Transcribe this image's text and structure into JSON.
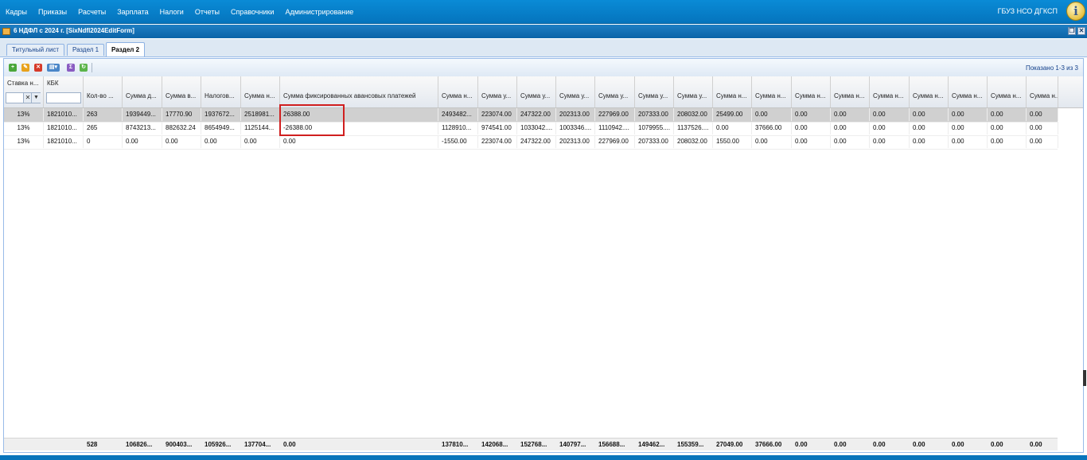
{
  "menu": [
    "Кадры",
    "Приказы",
    "Расчеты",
    "Зарплата",
    "Налоги",
    "Отчеты",
    "Справочники",
    "Администрирование"
  ],
  "org": "ГБУЗ НСО ДГКСП",
  "window": {
    "title": "6 НДФЛ с 2024 г. [SixNdfl2024EditForm]"
  },
  "tabs": [
    {
      "label": "Титульный лист",
      "active": false
    },
    {
      "label": "Раздел 1",
      "active": false
    },
    {
      "label": "Раздел 2",
      "active": true
    }
  ],
  "shown": "Показано 1-3 из 3",
  "columns": [
    "Ставка н...",
    "КБК",
    "Кол-во ...",
    "Сумма д...",
    "Сумма в...",
    "Налогов...",
    "Сумма н...",
    "Сумма фиксированных авансовых платежей",
    "Сумма н...",
    "Сумма у...",
    "Сумма у...",
    "Сумма у...",
    "Сумма у...",
    "Сумма у...",
    "Сумма у...",
    "Сумма н...",
    "Сумма н...",
    "Сумма н...",
    "Сумма н...",
    "Сумма н...",
    "Сумма н...",
    "Сумма н...",
    "Сумма н...",
    "Сумма н..."
  ],
  "rows": [
    [
      "13%",
      "1821010...",
      "263",
      "1939449...",
      "17770.90",
      "1937672...",
      "2518981...",
      "26388.00",
      "2493482...",
      "223074.00",
      "247322.00",
      "202313.00",
      "227969.00",
      "207333.00",
      "208032.00",
      "25499.00",
      "0.00",
      "0.00",
      "0.00",
      "0.00",
      "0.00",
      "0.00",
      "0.00",
      "0.00"
    ],
    [
      "13%",
      "1821010...",
      "265",
      "8743213...",
      "882632.24",
      "8654949...",
      "1125144...",
      "-26388.00",
      "1128910...",
      "974541.00",
      "1033042....",
      "1003346....",
      "1110942....",
      "1079955....",
      "1137526....",
      "0.00",
      "37666.00",
      "0.00",
      "0.00",
      "0.00",
      "0.00",
      "0.00",
      "0.00",
      "0.00"
    ],
    [
      "13%",
      "1821010...",
      "0",
      "0.00",
      "0.00",
      "0.00",
      "0.00",
      "0.00",
      "-1550.00",
      "223074.00",
      "247322.00",
      "202313.00",
      "227969.00",
      "207333.00",
      "208032.00",
      "1550.00",
      "0.00",
      "0.00",
      "0.00",
      "0.00",
      "0.00",
      "0.00",
      "0.00",
      "0.00"
    ]
  ],
  "totals": [
    "",
    "",
    "528",
    "106826...",
    "900403...",
    "105926...",
    "137704...",
    "0.00",
    "137810...",
    "142068...",
    "152768...",
    "140797...",
    "156688...",
    "149462...",
    "155359...",
    "27049.00",
    "37666.00",
    "0.00",
    "0.00",
    "0.00",
    "0.00",
    "0.00",
    "0.00",
    "0.00"
  ],
  "colors": {
    "topbar": "#0a7fcc",
    "highlight": "#d01f1f",
    "selected_row": "#d0d0d0"
  }
}
